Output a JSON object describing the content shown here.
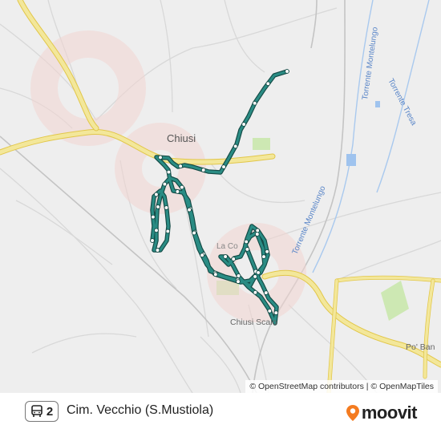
{
  "map": {
    "places": {
      "chiusi": "Chiusi",
      "chiusi_scalo": "Chiusi Scalo",
      "po_bandino": "Po' Ban",
      "la_co": "La Co"
    },
    "waterways": {
      "torrente_montelungo_north": "Torrente Montelungo",
      "torrente_tresa": "Torrente Tresa",
      "torrente_montelungo_south": "Torrente Montelungo"
    },
    "colors": {
      "route_line": "#2a8c84",
      "route_outline": "#134a45",
      "stop_fill": "#ffffff",
      "main_road": "#f3e79a",
      "main_road_edge": "#e2c74a",
      "water": "#9fc3ee",
      "park": "#cde8b3",
      "background": "#eeeeee"
    }
  },
  "attribution": {
    "osm": "© OpenStreetMap contributors",
    "sep": " | ",
    "omt": "© OpenMapTiles"
  },
  "route": {
    "number": "2",
    "destination": "Cim. Vecchio (S.Mustiola)",
    "icon": "bus-icon"
  },
  "brand": {
    "name": "moovit",
    "icon": "moovit-pin-icon"
  }
}
